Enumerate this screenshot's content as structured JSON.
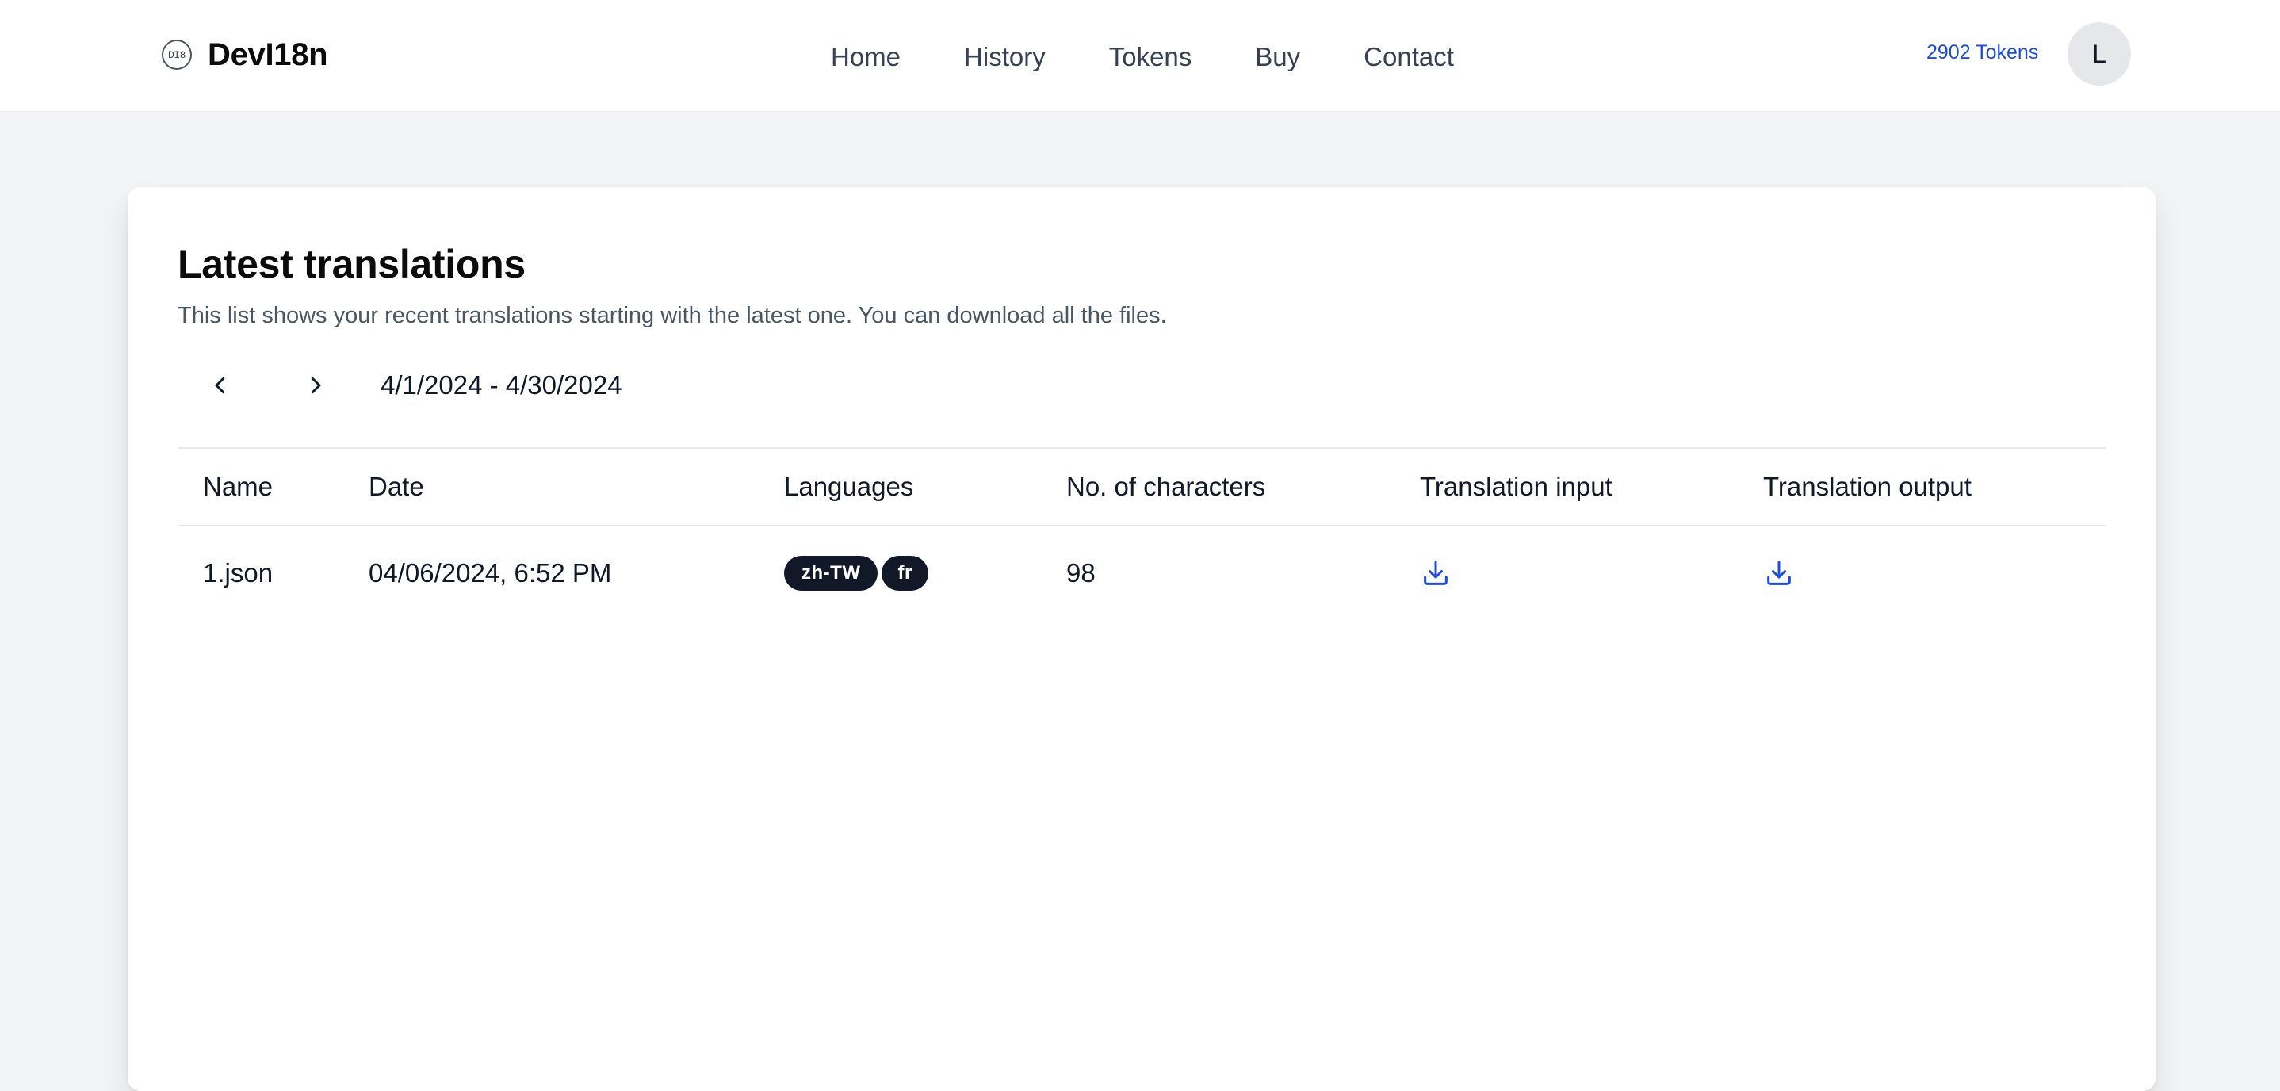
{
  "brand": {
    "logo_text": "DI8",
    "name": "DevI18n"
  },
  "nav": {
    "items": [
      {
        "label": "Home"
      },
      {
        "label": "History"
      },
      {
        "label": "Tokens"
      },
      {
        "label": "Buy"
      },
      {
        "label": "Contact"
      }
    ]
  },
  "account": {
    "tokens_label": "2902 Tokens",
    "avatar_initial": "L"
  },
  "main": {
    "title": "Latest translations",
    "subtitle": "This list shows your recent translations starting with the latest one. You can download all the files.",
    "date_range": "4/1/2024 - 4/30/2024"
  },
  "table": {
    "columns": [
      "Name",
      "Date",
      "Languages",
      "No. of characters",
      "Translation input",
      "Translation output"
    ],
    "rows": [
      {
        "name": "1.json",
        "date": "04/06/2024, 6:52 PM",
        "languages": [
          "zh-TW",
          "fr"
        ],
        "characters": "98"
      }
    ]
  },
  "icons": {
    "prev": "chevron-left-icon",
    "next": "chevron-right-icon",
    "download": "download-icon"
  },
  "colors": {
    "accent": "#1d4ed8",
    "badge_bg": "#111827",
    "page_bg": "#f3f4f6"
  }
}
